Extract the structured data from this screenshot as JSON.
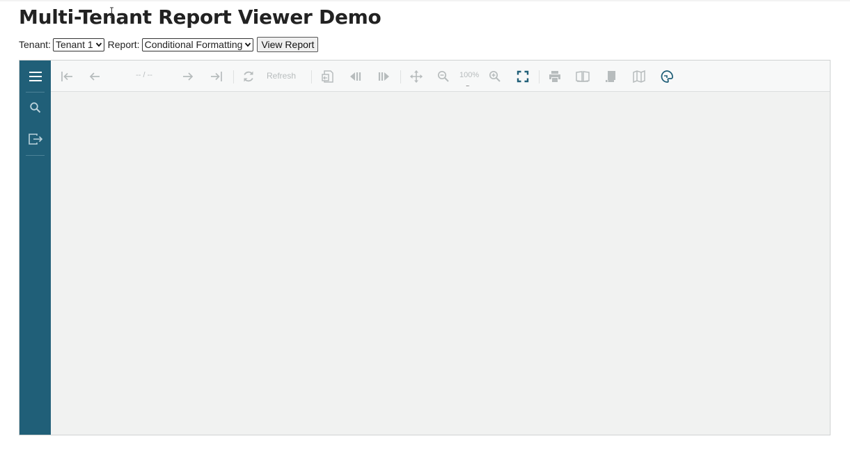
{
  "page": {
    "title": "Multi-Tenant Report Viewer Demo"
  },
  "controls": {
    "tenant_label": "Tenant:",
    "tenant_selected": "Tenant 1",
    "report_label": "Report:",
    "report_selected": "Conditional Formatting",
    "view_button": "View Report"
  },
  "viewer": {
    "colors": {
      "sidebar": "#205f78",
      "toolbar": "#f7f8f8",
      "content": "#f1f2f1",
      "icon_disabled": "#b7bcbd",
      "icon_active": "#205f78"
    },
    "sidebar": {
      "items": [
        {
          "icon": "hamburger-menu-icon"
        },
        {
          "icon": "search-icon"
        },
        {
          "icon": "export-icon"
        }
      ]
    },
    "toolbar": {
      "page_indicator": "-- / --",
      "refresh_label": "Refresh",
      "zoom_value": "100%",
      "zoom_more": "...",
      "icons": [
        "first-page-icon",
        "previous-page-icon",
        "next-page-icon",
        "last-page-icon",
        "refresh-icon",
        "back-to-parent-icon",
        "previous-section-icon",
        "next-section-icon",
        "pan-icon",
        "zoom-out-icon",
        "zoom-in-icon",
        "fullscreen-icon",
        "print-icon",
        "continuous-view-icon",
        "single-page-icon",
        "map-view-icon",
        "theme-icon"
      ]
    }
  }
}
